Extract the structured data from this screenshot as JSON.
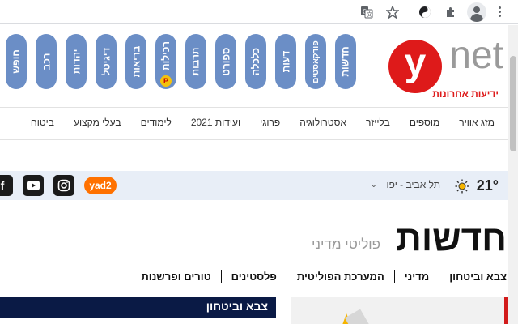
{
  "browser": {
    "toolbar_icons": [
      "translate-icon",
      "star-icon",
      "color-theme-icon",
      "extensions-icon",
      "profile-avatar-icon",
      "menu-icon"
    ]
  },
  "site": {
    "logo_letter": "y",
    "logo_word": "net",
    "logo_tagline": "ידיעות אחרונות"
  },
  "categories": [
    {
      "label": "חדשות",
      "small": false
    },
    {
      "label": "פודקאסטים",
      "small": true
    },
    {
      "label": "דעות",
      "small": false
    },
    {
      "label": "כלכלה",
      "small": false
    },
    {
      "label": "ספורט",
      "small": false
    },
    {
      "label": "תרבות",
      "small": false
    },
    {
      "label": "רכילות",
      "small": false
    },
    {
      "label": "בריאות",
      "small": false
    },
    {
      "label": "דיגיטל",
      "small": false
    },
    {
      "label": "יהדות",
      "small": false
    },
    {
      "label": "רכב",
      "small": false
    },
    {
      "label": "חופש",
      "small": false
    }
  ],
  "rechilut_badge": "P",
  "subnav": [
    "מזג אוויר",
    "מוספים",
    "בלייזר",
    "אסטרולוגיה",
    "פרוגי",
    "ועידות 2021",
    "לימודים",
    "בעלי מקצוע",
    "ביטוח"
  ],
  "weather": {
    "temperature": "21°",
    "city": "תל אביב - יפו",
    "caret": "⌄"
  },
  "social": {
    "yad2": "yad2"
  },
  "section": {
    "title": "חדשות",
    "subtitle": "פוליטי מדיני"
  },
  "tabs": [
    "צבא וביטחון",
    "מדיני",
    "המערכת הפוליטית",
    "פלסטינים",
    "טורים ופרשנות"
  ],
  "strip_title": "צבא וביטחון"
}
